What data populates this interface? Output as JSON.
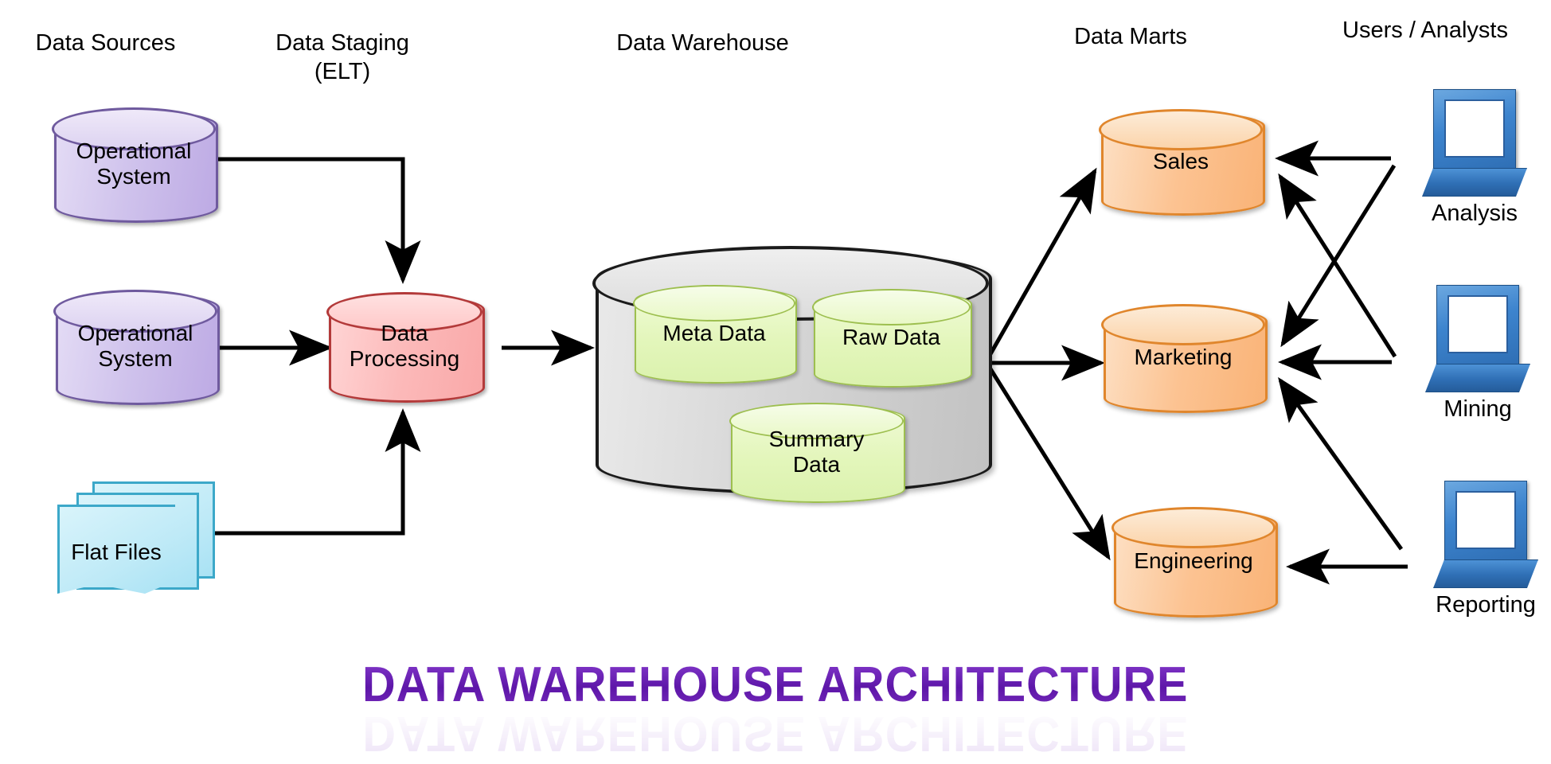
{
  "diagram": {
    "title": "DATA WAREHOUSE ARCHITECTURE",
    "columns": [
      {
        "id": "data-sources",
        "label": "Data Sources"
      },
      {
        "id": "data-staging",
        "label": "Data Staging\n(ELT)"
      },
      {
        "id": "data-warehouse",
        "label": "Data Warehouse"
      },
      {
        "id": "data-marts",
        "label": "Data Marts"
      },
      {
        "id": "users-analysts",
        "label": "Users / Analysts"
      }
    ],
    "sources": [
      {
        "id": "operational-system-1",
        "label": "Operational\nSystem",
        "shape": "cylinder",
        "color": "#cfc2ec"
      },
      {
        "id": "operational-system-2",
        "label": "Operational\nSystem",
        "shape": "cylinder",
        "color": "#cfc2ec"
      },
      {
        "id": "flat-files",
        "label": "Flat Files",
        "shape": "document-stack",
        "color": "#bfeaf7"
      }
    ],
    "staging": {
      "id": "data-processing",
      "label": "Data\nProcessing",
      "shape": "cylinder",
      "color": "#fcb9b9"
    },
    "warehouse": {
      "id": "data-warehouse-shell",
      "shape": "cylinder",
      "color": "#d6d6d6",
      "stores": [
        {
          "id": "meta-data",
          "label": "Meta Data",
          "color": "#e3f6bb"
        },
        {
          "id": "raw-data",
          "label": "Raw Data",
          "color": "#e3f6bb"
        },
        {
          "id": "summary-data",
          "label": "Summary\nData",
          "color": "#e3f6bb"
        }
      ]
    },
    "marts": [
      {
        "id": "sales",
        "label": "Sales",
        "shape": "cylinder",
        "color": "#fcc392"
      },
      {
        "id": "marketing",
        "label": "Marketing",
        "shape": "cylinder",
        "color": "#fcc392"
      },
      {
        "id": "engineering",
        "label": "Engineering",
        "shape": "cylinder",
        "color": "#fcc392"
      }
    ],
    "users": [
      {
        "id": "analysis",
        "label": "Analysis",
        "shape": "laptop",
        "color": "#3d84ce"
      },
      {
        "id": "mining",
        "label": "Mining",
        "shape": "laptop",
        "color": "#3d84ce"
      },
      {
        "id": "reporting",
        "label": "Reporting",
        "shape": "laptop",
        "color": "#3d84ce"
      }
    ],
    "flows": [
      {
        "from": "operational-system-1",
        "to": "data-processing"
      },
      {
        "from": "operational-system-2",
        "to": "data-processing"
      },
      {
        "from": "flat-files",
        "to": "data-processing"
      },
      {
        "from": "data-processing",
        "to": "data-warehouse-shell"
      },
      {
        "from": "data-warehouse-shell",
        "to": "sales"
      },
      {
        "from": "data-warehouse-shell",
        "to": "marketing"
      },
      {
        "from": "data-warehouse-shell",
        "to": "engineering"
      },
      {
        "from": "analysis",
        "to": "sales"
      },
      {
        "from": "analysis",
        "to": "marketing"
      },
      {
        "from": "mining",
        "to": "sales"
      },
      {
        "from": "mining",
        "to": "marketing"
      },
      {
        "from": "reporting",
        "to": "marketing"
      },
      {
        "from": "reporting",
        "to": "engineering"
      }
    ],
    "colors": {
      "title": "#6a1fb0",
      "source_fill": "#cfc2ec",
      "source_stroke": "#6f5a9e",
      "staging_fill": "#fcb9b9",
      "staging_stroke": "#b33a3a",
      "warehouse_fill": "#d6d6d6",
      "warehouse_stroke": "#1b1b1b",
      "store_fill": "#e3f6bb",
      "store_stroke": "#9dbf4f",
      "mart_fill": "#fcc392",
      "mart_stroke": "#e0862c",
      "laptop_fill": "#3d84ce",
      "files_fill": "#bfeaf7",
      "files_stroke": "#3ca8c9",
      "arrow": "#000000",
      "background": "#ffffff"
    }
  }
}
